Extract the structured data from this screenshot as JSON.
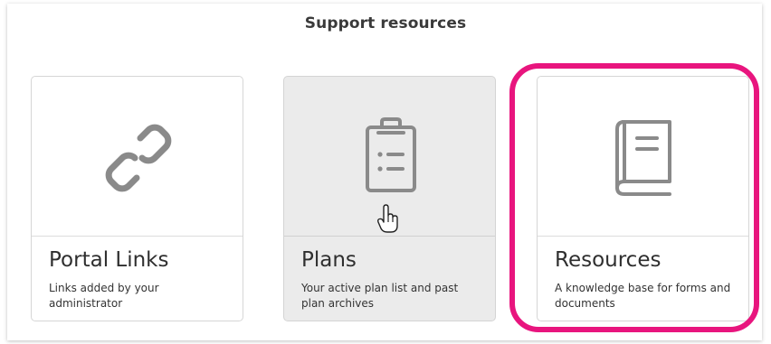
{
  "section": {
    "title": "Support resources"
  },
  "cards": [
    {
      "title": "Portal Links",
      "description": "Links added by your administrator",
      "icon": "link-icon"
    },
    {
      "title": "Plans",
      "description": "Your active plan list and past plan archives",
      "icon": "clipboard-list-icon"
    },
    {
      "title": "Resources",
      "description": "A knowledge base for forms and documents",
      "icon": "book-icon"
    }
  ],
  "highlight": {
    "color": "#e8157e"
  },
  "colors": {
    "icon_gray": "#8a8a8a",
    "hover_card_bg": "#ebebeb"
  }
}
